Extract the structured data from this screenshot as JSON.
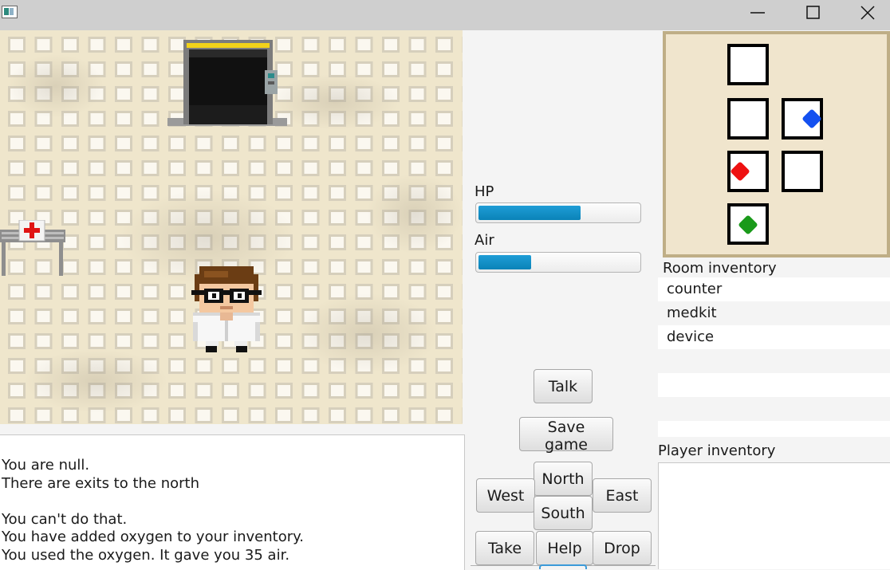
{
  "window": {
    "minimize_icon": "minimize-icon",
    "maximize_icon": "maximize-icon",
    "close_icon": "close-icon"
  },
  "stats": {
    "hp_label": "HP",
    "hp_fraction": 0.64,
    "air_label": "Air",
    "air_fraction": 0.33,
    "bar_color": "#0a8fc9"
  },
  "log": {
    "lines": [
      "You are null.",
      "There are exits to the north",
      "",
      "You can't do that.",
      "You have added oxygen to your inventory.",
      "You used the oxygen. It gave you 35 air."
    ]
  },
  "buttons": {
    "talk": "Talk",
    "save_game": "Save game",
    "north": "North",
    "west": "West",
    "east": "East",
    "south": "South",
    "take": "Take",
    "help": "Help",
    "drop": "Drop"
  },
  "map": {
    "dot_colors": {
      "blue": "#1450f0",
      "red": "#ee1111",
      "green": "#1a9a1a"
    }
  },
  "room_inventory": {
    "label": "Room inventory",
    "items": [
      "counter",
      "medkit",
      "device",
      "",
      "",
      "",
      ""
    ]
  },
  "player_inventory": {
    "label": "Player inventory",
    "items": []
  }
}
